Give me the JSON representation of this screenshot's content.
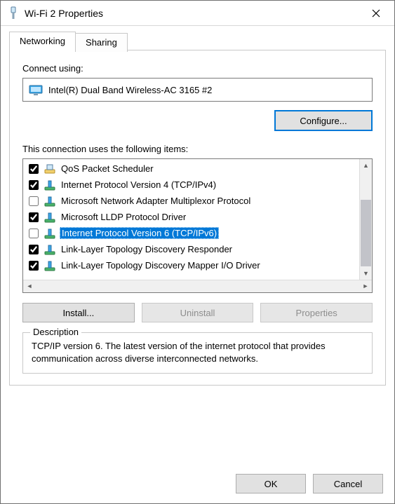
{
  "window": {
    "title": "Wi-Fi 2 Properties"
  },
  "tabs": {
    "networking": "Networking",
    "sharing": "Sharing"
  },
  "labels": {
    "connect_using": "Connect using:",
    "items_heading": "This connection uses the following items:",
    "description_legend": "Description"
  },
  "adapter": {
    "name": "Intel(R) Dual Band Wireless-AC 3165 #2"
  },
  "buttons": {
    "configure": "Configure...",
    "install": "Install...",
    "uninstall": "Uninstall",
    "properties": "Properties",
    "ok": "OK",
    "cancel": "Cancel"
  },
  "items": [
    {
      "checked": true,
      "icon": "qos",
      "label": "QoS Packet Scheduler",
      "selected": false
    },
    {
      "checked": true,
      "icon": "proto",
      "label": "Internet Protocol Version 4 (TCP/IPv4)",
      "selected": false
    },
    {
      "checked": false,
      "icon": "proto",
      "label": "Microsoft Network Adapter Multiplexor Protocol",
      "selected": false
    },
    {
      "checked": true,
      "icon": "proto",
      "label": "Microsoft LLDP Protocol Driver",
      "selected": false
    },
    {
      "checked": false,
      "icon": "proto",
      "label": "Internet Protocol Version 6 (TCP/IPv6)",
      "selected": true
    },
    {
      "checked": true,
      "icon": "proto",
      "label": "Link-Layer Topology Discovery Responder",
      "selected": false
    },
    {
      "checked": true,
      "icon": "proto",
      "label": "Link-Layer Topology Discovery Mapper I/O Driver",
      "selected": false
    }
  ],
  "description": "TCP/IP version 6. The latest version of the internet protocol that provides communication across diverse interconnected networks."
}
